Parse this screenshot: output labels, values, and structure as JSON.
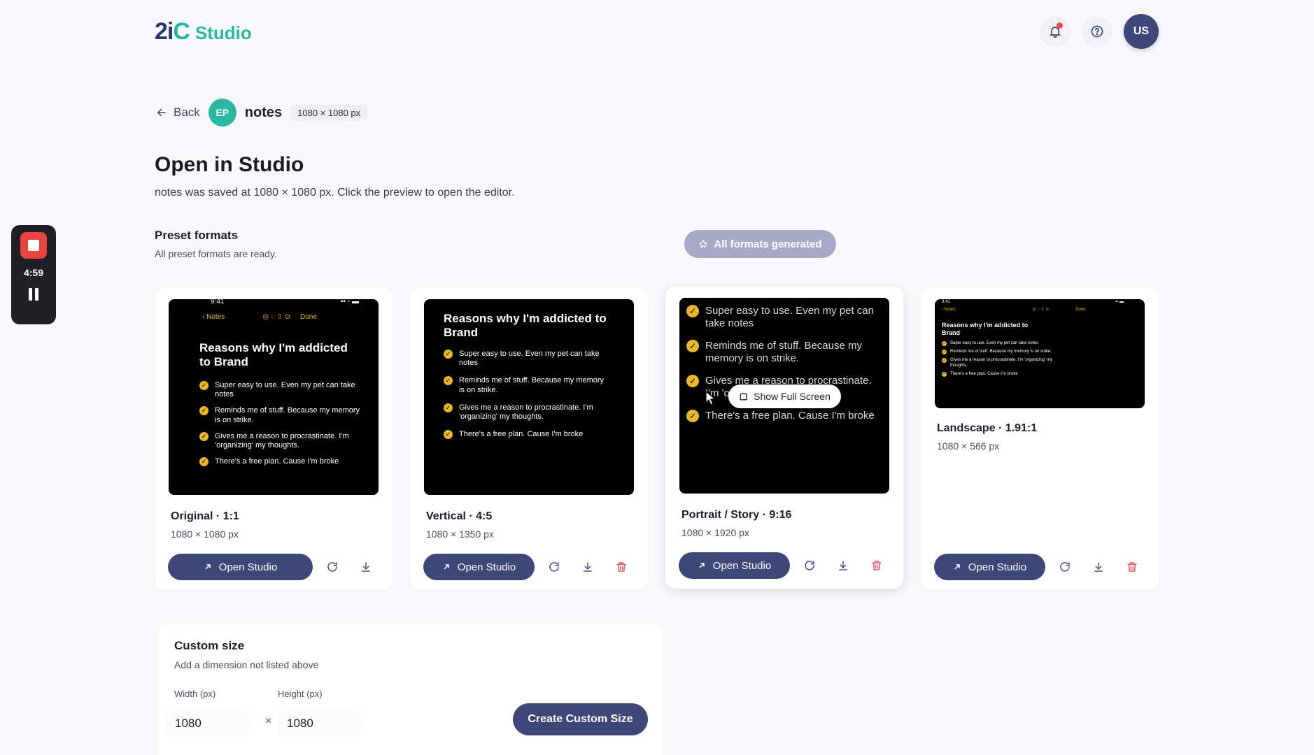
{
  "app": {
    "logo_mark": "2iC",
    "logo_text": "Studio",
    "user_initials": "US"
  },
  "breadcrumb": {
    "back_label": "Back",
    "project_initials": "EP",
    "title": "notes",
    "dimensions": "1080 × 1080 px"
  },
  "page": {
    "title": "Open in Studio",
    "subtitle": "notes was saved at 1080 × 1080 px. Click the preview to open the editor."
  },
  "presets": {
    "title": "Preset formats",
    "subtitle": "All preset formats are ready.",
    "status_button": "All formats generated"
  },
  "recorder": {
    "time": "4:59"
  },
  "note": {
    "status_time": "9:41",
    "nav_back": "Notes",
    "nav_done": "Done",
    "heading": "Reasons why I'm addicted to Brand",
    "items": [
      "Super easy to use. Even my pet can take notes",
      "Reminds me of stuff. Because my memory is on strike.",
      "Gives me a reason to procrastinate. I'm 'organizing' my thoughts.",
      "There's a free plan. Cause I'm broke"
    ]
  },
  "cards": [
    {
      "title": "Original · 1:1",
      "dims": "1080 × 1080 px",
      "open_label": "Open Studio"
    },
    {
      "title": "Vertical · 4:5",
      "dims": "1080 × 1350 px",
      "open_label": "Open Studio"
    },
    {
      "title": "Portrait / Story · 9:16",
      "dims": "1080 × 1920 px",
      "open_label": "Open Studio"
    },
    {
      "title": "Landscape · 1.91:1",
      "dims": "1080 × 566 px",
      "open_label": "Open Studio"
    }
  ],
  "show_full_screen": "Show Full Screen",
  "custom": {
    "title": "Custom size",
    "subtitle": "Add a dimension not listed above",
    "width_label": "Width (px)",
    "height_label": "Height (px)",
    "width_value": "1080",
    "height_value": "1080",
    "times": "×",
    "create_label": "Create Custom Size"
  },
  "colors": {
    "primary": "#3f4779",
    "accent": "#2bb7a2",
    "check": "#e8b72c",
    "danger": "#e0566a"
  }
}
